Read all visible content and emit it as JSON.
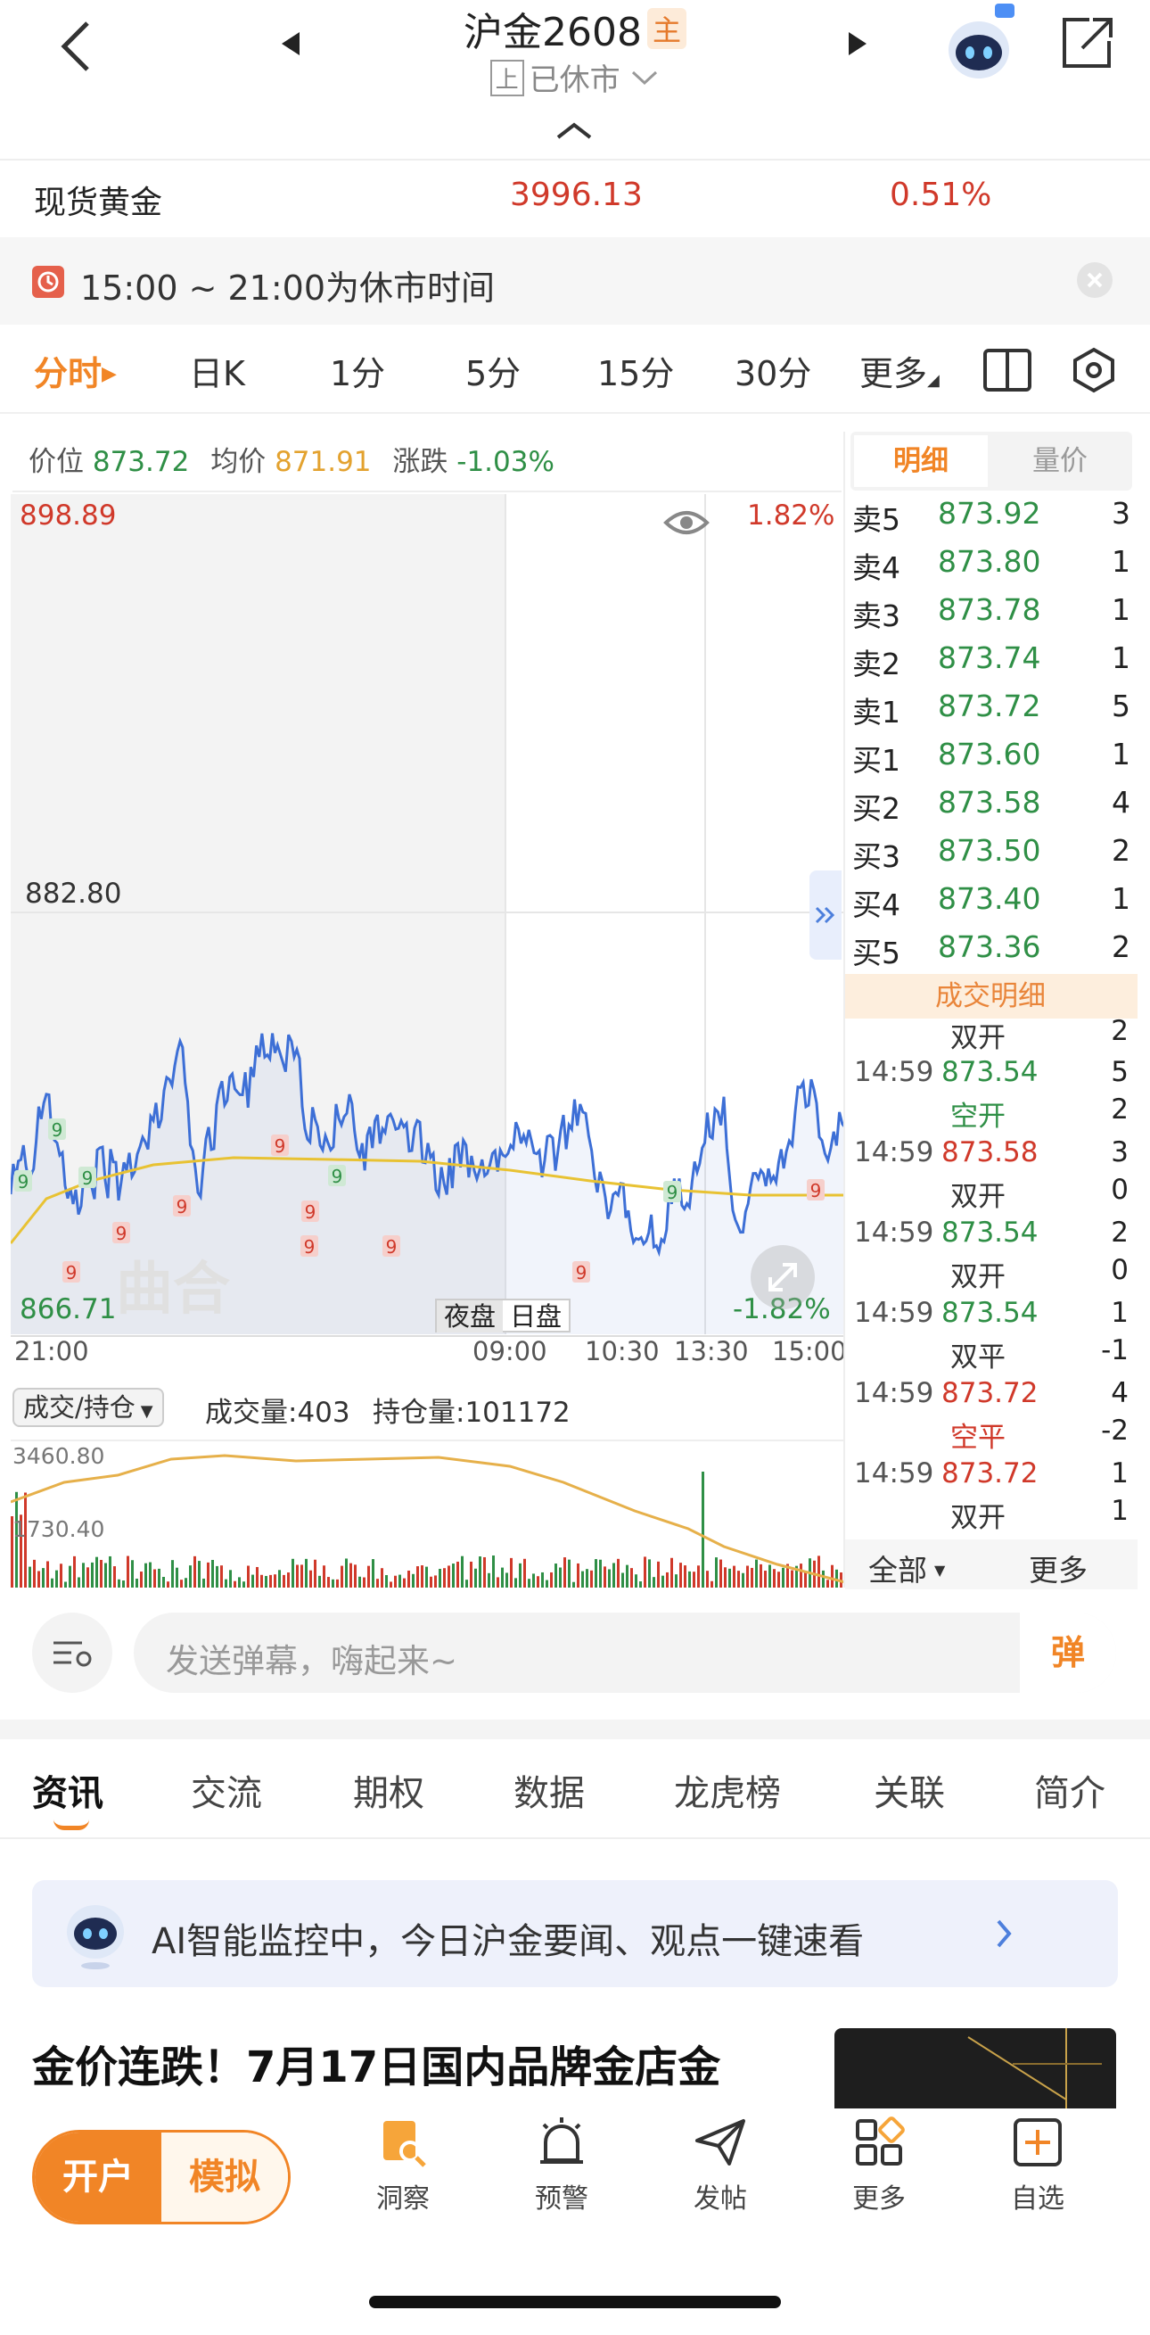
{
  "header": {
    "title": "沪金2608",
    "main_tag": "主",
    "exchange_tag": "上",
    "status": "已休市"
  },
  "spot": {
    "name": "现货黄金",
    "price": "3996.13",
    "change": "0.51%"
  },
  "notice": {
    "text": "15:00 ~ 21:00为休市时间"
  },
  "period_tabs": [
    "分时",
    "日K",
    "1分",
    "5分",
    "15分",
    "30分",
    "更多"
  ],
  "chart": {
    "price_label": "价位",
    "price": "873.72",
    "avg_label": "均价",
    "avg": "871.91",
    "chg_label": "涨跌",
    "chg": "-1.03%",
    "y_max": "898.89",
    "y_mid": "882.80",
    "y_min": "866.71",
    "pct_max": "1.82%",
    "pct_min": "-1.82%",
    "x_labels": [
      "21:00",
      "09:00",
      "10:30",
      "13:30",
      "15:00"
    ],
    "night_btn": "夜盘",
    "day_btn": "日盘",
    "watermark": "曲合"
  },
  "volume": {
    "selector": "成交/持仓",
    "vol_label": "成交量:403",
    "oi_label": "持仓量:101172",
    "y_top": "3460.80",
    "y_mid": "1730.40"
  },
  "orderbook": {
    "tabs": [
      "明细",
      "量价"
    ],
    "rows": [
      {
        "label": "卖5",
        "price": "873.92",
        "qty": "3"
      },
      {
        "label": "卖4",
        "price": "873.80",
        "qty": "1"
      },
      {
        "label": "卖3",
        "price": "873.78",
        "qty": "1"
      },
      {
        "label": "卖2",
        "price": "873.74",
        "qty": "1"
      },
      {
        "label": "卖1",
        "price": "873.72",
        "qty": "5"
      },
      {
        "label": "买1",
        "price": "873.60",
        "qty": "1"
      },
      {
        "label": "买2",
        "price": "873.58",
        "qty": "4"
      },
      {
        "label": "买3",
        "price": "873.50",
        "qty": "2"
      },
      {
        "label": "买4",
        "price": "873.40",
        "qty": "1"
      },
      {
        "label": "买5",
        "price": "873.36",
        "qty": "2"
      }
    ],
    "trades_title": "成交明细",
    "trades": [
      {
        "time": "",
        "price": "",
        "qty": "",
        "type": "双开",
        "type_qty": "2",
        "color": "red"
      },
      {
        "time": "14:59",
        "price": "873.54",
        "qty": "5",
        "type": "空开",
        "type_qty": "2",
        "color": "green"
      },
      {
        "time": "14:59",
        "price": "873.58",
        "qty": "3",
        "type": "双开",
        "type_qty": "0",
        "color": "red"
      },
      {
        "time": "14:59",
        "price": "873.54",
        "qty": "2",
        "type": "双开",
        "type_qty": "0",
        "color": "green"
      },
      {
        "time": "14:59",
        "price": "873.54",
        "qty": "1",
        "type": "双平",
        "type_qty": "-1",
        "color": "green"
      },
      {
        "time": "14:59",
        "price": "873.72",
        "qty": "4",
        "type": "空平",
        "type_qty": "-2",
        "color": "red"
      },
      {
        "time": "14:59",
        "price": "873.72",
        "qty": "1",
        "type": "双开",
        "type_qty": "1",
        "color": "red"
      }
    ],
    "all_btn": "全部",
    "more_btn": "更多"
  },
  "danmaku": {
    "placeholder": "发送弹幕，嗨起来~",
    "send": "弹"
  },
  "news_tabs": [
    "资讯",
    "交流",
    "期权",
    "数据",
    "龙虎榜",
    "关联",
    "简介"
  ],
  "ai_banner": {
    "text": "AI智能监控中，今日沪金要闻、观点一键速看"
  },
  "news": {
    "headline": "金价连跌！7月17日国内品牌金店金"
  },
  "bottom_nav": {
    "open_account": "开户",
    "simulate": "模拟",
    "items": [
      {
        "label": "洞察",
        "icon": "insight-icon"
      },
      {
        "label": "预警",
        "icon": "alarm-icon"
      },
      {
        "label": "发帖",
        "icon": "post-icon"
      },
      {
        "label": "更多",
        "icon": "grid-icon"
      },
      {
        "label": "自选",
        "icon": "add-watch-icon"
      }
    ]
  },
  "colors": {
    "up": "#d0392a",
    "down": "#2f8f46",
    "accent": "#f18526",
    "price_line": "#3d6fd6",
    "avg_line": "#e8c233"
  }
}
